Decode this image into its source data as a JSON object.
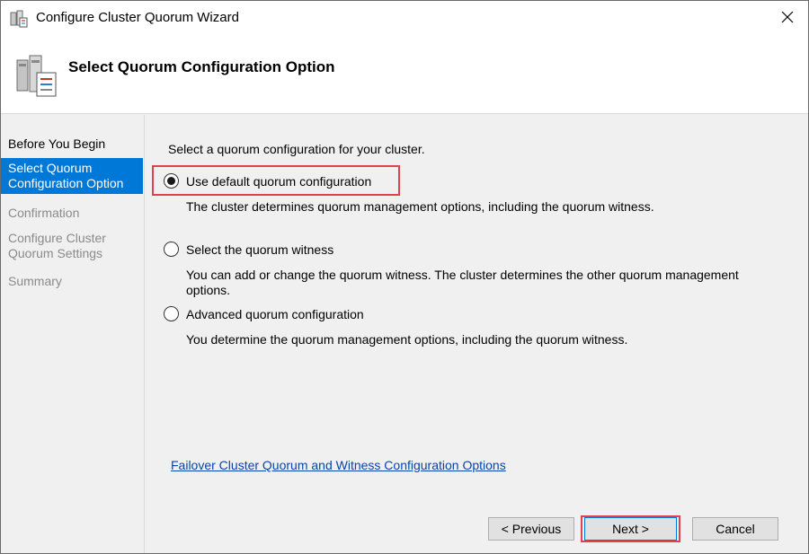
{
  "window": {
    "title": "Configure Cluster Quorum Wizard",
    "close_icon": "close-icon"
  },
  "header": {
    "title": "Select Quorum Configuration Option",
    "icon": "cluster-servers-icon"
  },
  "nav": {
    "items": [
      {
        "label": "Before You Begin",
        "state": "normal"
      },
      {
        "label": "Select Quorum Configuration Option",
        "state": "active"
      },
      {
        "label": "Confirmation",
        "state": "disabled"
      },
      {
        "label": "Configure Cluster Quorum Settings",
        "state": "disabled"
      },
      {
        "label": "Summary",
        "state": "disabled"
      }
    ]
  },
  "content": {
    "intro": "Select a quorum configuration for your cluster.",
    "options": [
      {
        "label": "Use default quorum configuration",
        "description": "The cluster determines quorum management options, including the quorum witness.",
        "selected": true
      },
      {
        "label": "Select the quorum witness",
        "description": "You can add or change the quorum witness. The cluster determines the other quorum management options.",
        "selected": false
      },
      {
        "label": "Advanced quorum configuration",
        "description": "You determine the quorum management options, including the quorum witness.",
        "selected": false
      }
    ],
    "help_link": "Failover Cluster Quorum and Witness Configuration Options"
  },
  "buttons": {
    "previous": "< Previous",
    "next": "Next >",
    "cancel": "Cancel"
  },
  "colors": {
    "accent": "#0078d7",
    "highlight_box": "#e0424d",
    "link": "#0645ad"
  }
}
